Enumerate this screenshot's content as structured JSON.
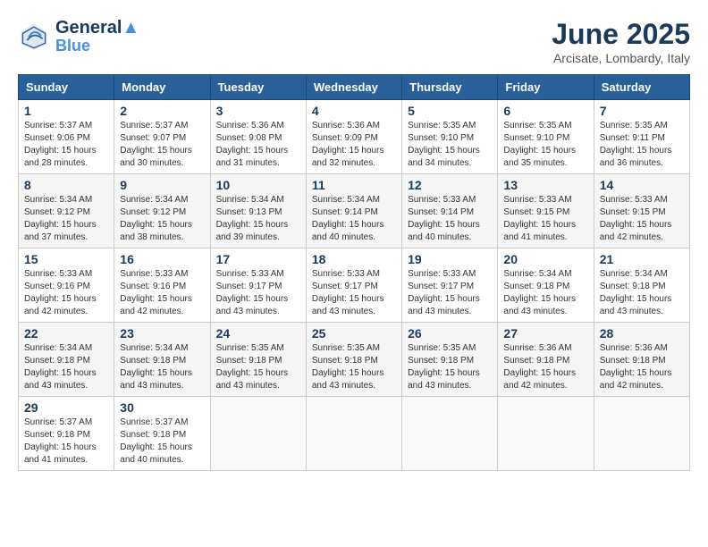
{
  "header": {
    "logo_line1": "General",
    "logo_line2": "Blue",
    "month_title": "June 2025",
    "location": "Arcisate, Lombardy, Italy"
  },
  "weekdays": [
    "Sunday",
    "Monday",
    "Tuesday",
    "Wednesday",
    "Thursday",
    "Friday",
    "Saturday"
  ],
  "weeks": [
    [
      {
        "day": "1",
        "sunrise": "5:37 AM",
        "sunset": "9:06 PM",
        "daylight": "15 hours and 28 minutes."
      },
      {
        "day": "2",
        "sunrise": "5:37 AM",
        "sunset": "9:07 PM",
        "daylight": "15 hours and 30 minutes."
      },
      {
        "day": "3",
        "sunrise": "5:36 AM",
        "sunset": "9:08 PM",
        "daylight": "15 hours and 31 minutes."
      },
      {
        "day": "4",
        "sunrise": "5:36 AM",
        "sunset": "9:09 PM",
        "daylight": "15 hours and 32 minutes."
      },
      {
        "day": "5",
        "sunrise": "5:35 AM",
        "sunset": "9:10 PM",
        "daylight": "15 hours and 34 minutes."
      },
      {
        "day": "6",
        "sunrise": "5:35 AM",
        "sunset": "9:10 PM",
        "daylight": "15 hours and 35 minutes."
      },
      {
        "day": "7",
        "sunrise": "5:35 AM",
        "sunset": "9:11 PM",
        "daylight": "15 hours and 36 minutes."
      }
    ],
    [
      {
        "day": "8",
        "sunrise": "5:34 AM",
        "sunset": "9:12 PM",
        "daylight": "15 hours and 37 minutes."
      },
      {
        "day": "9",
        "sunrise": "5:34 AM",
        "sunset": "9:12 PM",
        "daylight": "15 hours and 38 minutes."
      },
      {
        "day": "10",
        "sunrise": "5:34 AM",
        "sunset": "9:13 PM",
        "daylight": "15 hours and 39 minutes."
      },
      {
        "day": "11",
        "sunrise": "5:34 AM",
        "sunset": "9:14 PM",
        "daylight": "15 hours and 40 minutes."
      },
      {
        "day": "12",
        "sunrise": "5:33 AM",
        "sunset": "9:14 PM",
        "daylight": "15 hours and 40 minutes."
      },
      {
        "day": "13",
        "sunrise": "5:33 AM",
        "sunset": "9:15 PM",
        "daylight": "15 hours and 41 minutes."
      },
      {
        "day": "14",
        "sunrise": "5:33 AM",
        "sunset": "9:15 PM",
        "daylight": "15 hours and 42 minutes."
      }
    ],
    [
      {
        "day": "15",
        "sunrise": "5:33 AM",
        "sunset": "9:16 PM",
        "daylight": "15 hours and 42 minutes."
      },
      {
        "day": "16",
        "sunrise": "5:33 AM",
        "sunset": "9:16 PM",
        "daylight": "15 hours and 42 minutes."
      },
      {
        "day": "17",
        "sunrise": "5:33 AM",
        "sunset": "9:17 PM",
        "daylight": "15 hours and 43 minutes."
      },
      {
        "day": "18",
        "sunrise": "5:33 AM",
        "sunset": "9:17 PM",
        "daylight": "15 hours and 43 minutes."
      },
      {
        "day": "19",
        "sunrise": "5:33 AM",
        "sunset": "9:17 PM",
        "daylight": "15 hours and 43 minutes."
      },
      {
        "day": "20",
        "sunrise": "5:34 AM",
        "sunset": "9:18 PM",
        "daylight": "15 hours and 43 minutes."
      },
      {
        "day": "21",
        "sunrise": "5:34 AM",
        "sunset": "9:18 PM",
        "daylight": "15 hours and 43 minutes."
      }
    ],
    [
      {
        "day": "22",
        "sunrise": "5:34 AM",
        "sunset": "9:18 PM",
        "daylight": "15 hours and 43 minutes."
      },
      {
        "day": "23",
        "sunrise": "5:34 AM",
        "sunset": "9:18 PM",
        "daylight": "15 hours and 43 minutes."
      },
      {
        "day": "24",
        "sunrise": "5:35 AM",
        "sunset": "9:18 PM",
        "daylight": "15 hours and 43 minutes."
      },
      {
        "day": "25",
        "sunrise": "5:35 AM",
        "sunset": "9:18 PM",
        "daylight": "15 hours and 43 minutes."
      },
      {
        "day": "26",
        "sunrise": "5:35 AM",
        "sunset": "9:18 PM",
        "daylight": "15 hours and 43 minutes."
      },
      {
        "day": "27",
        "sunrise": "5:36 AM",
        "sunset": "9:18 PM",
        "daylight": "15 hours and 42 minutes."
      },
      {
        "day": "28",
        "sunrise": "5:36 AM",
        "sunset": "9:18 PM",
        "daylight": "15 hours and 42 minutes."
      }
    ],
    [
      {
        "day": "29",
        "sunrise": "5:37 AM",
        "sunset": "9:18 PM",
        "daylight": "15 hours and 41 minutes."
      },
      {
        "day": "30",
        "sunrise": "5:37 AM",
        "sunset": "9:18 PM",
        "daylight": "15 hours and 40 minutes."
      },
      null,
      null,
      null,
      null,
      null
    ]
  ]
}
